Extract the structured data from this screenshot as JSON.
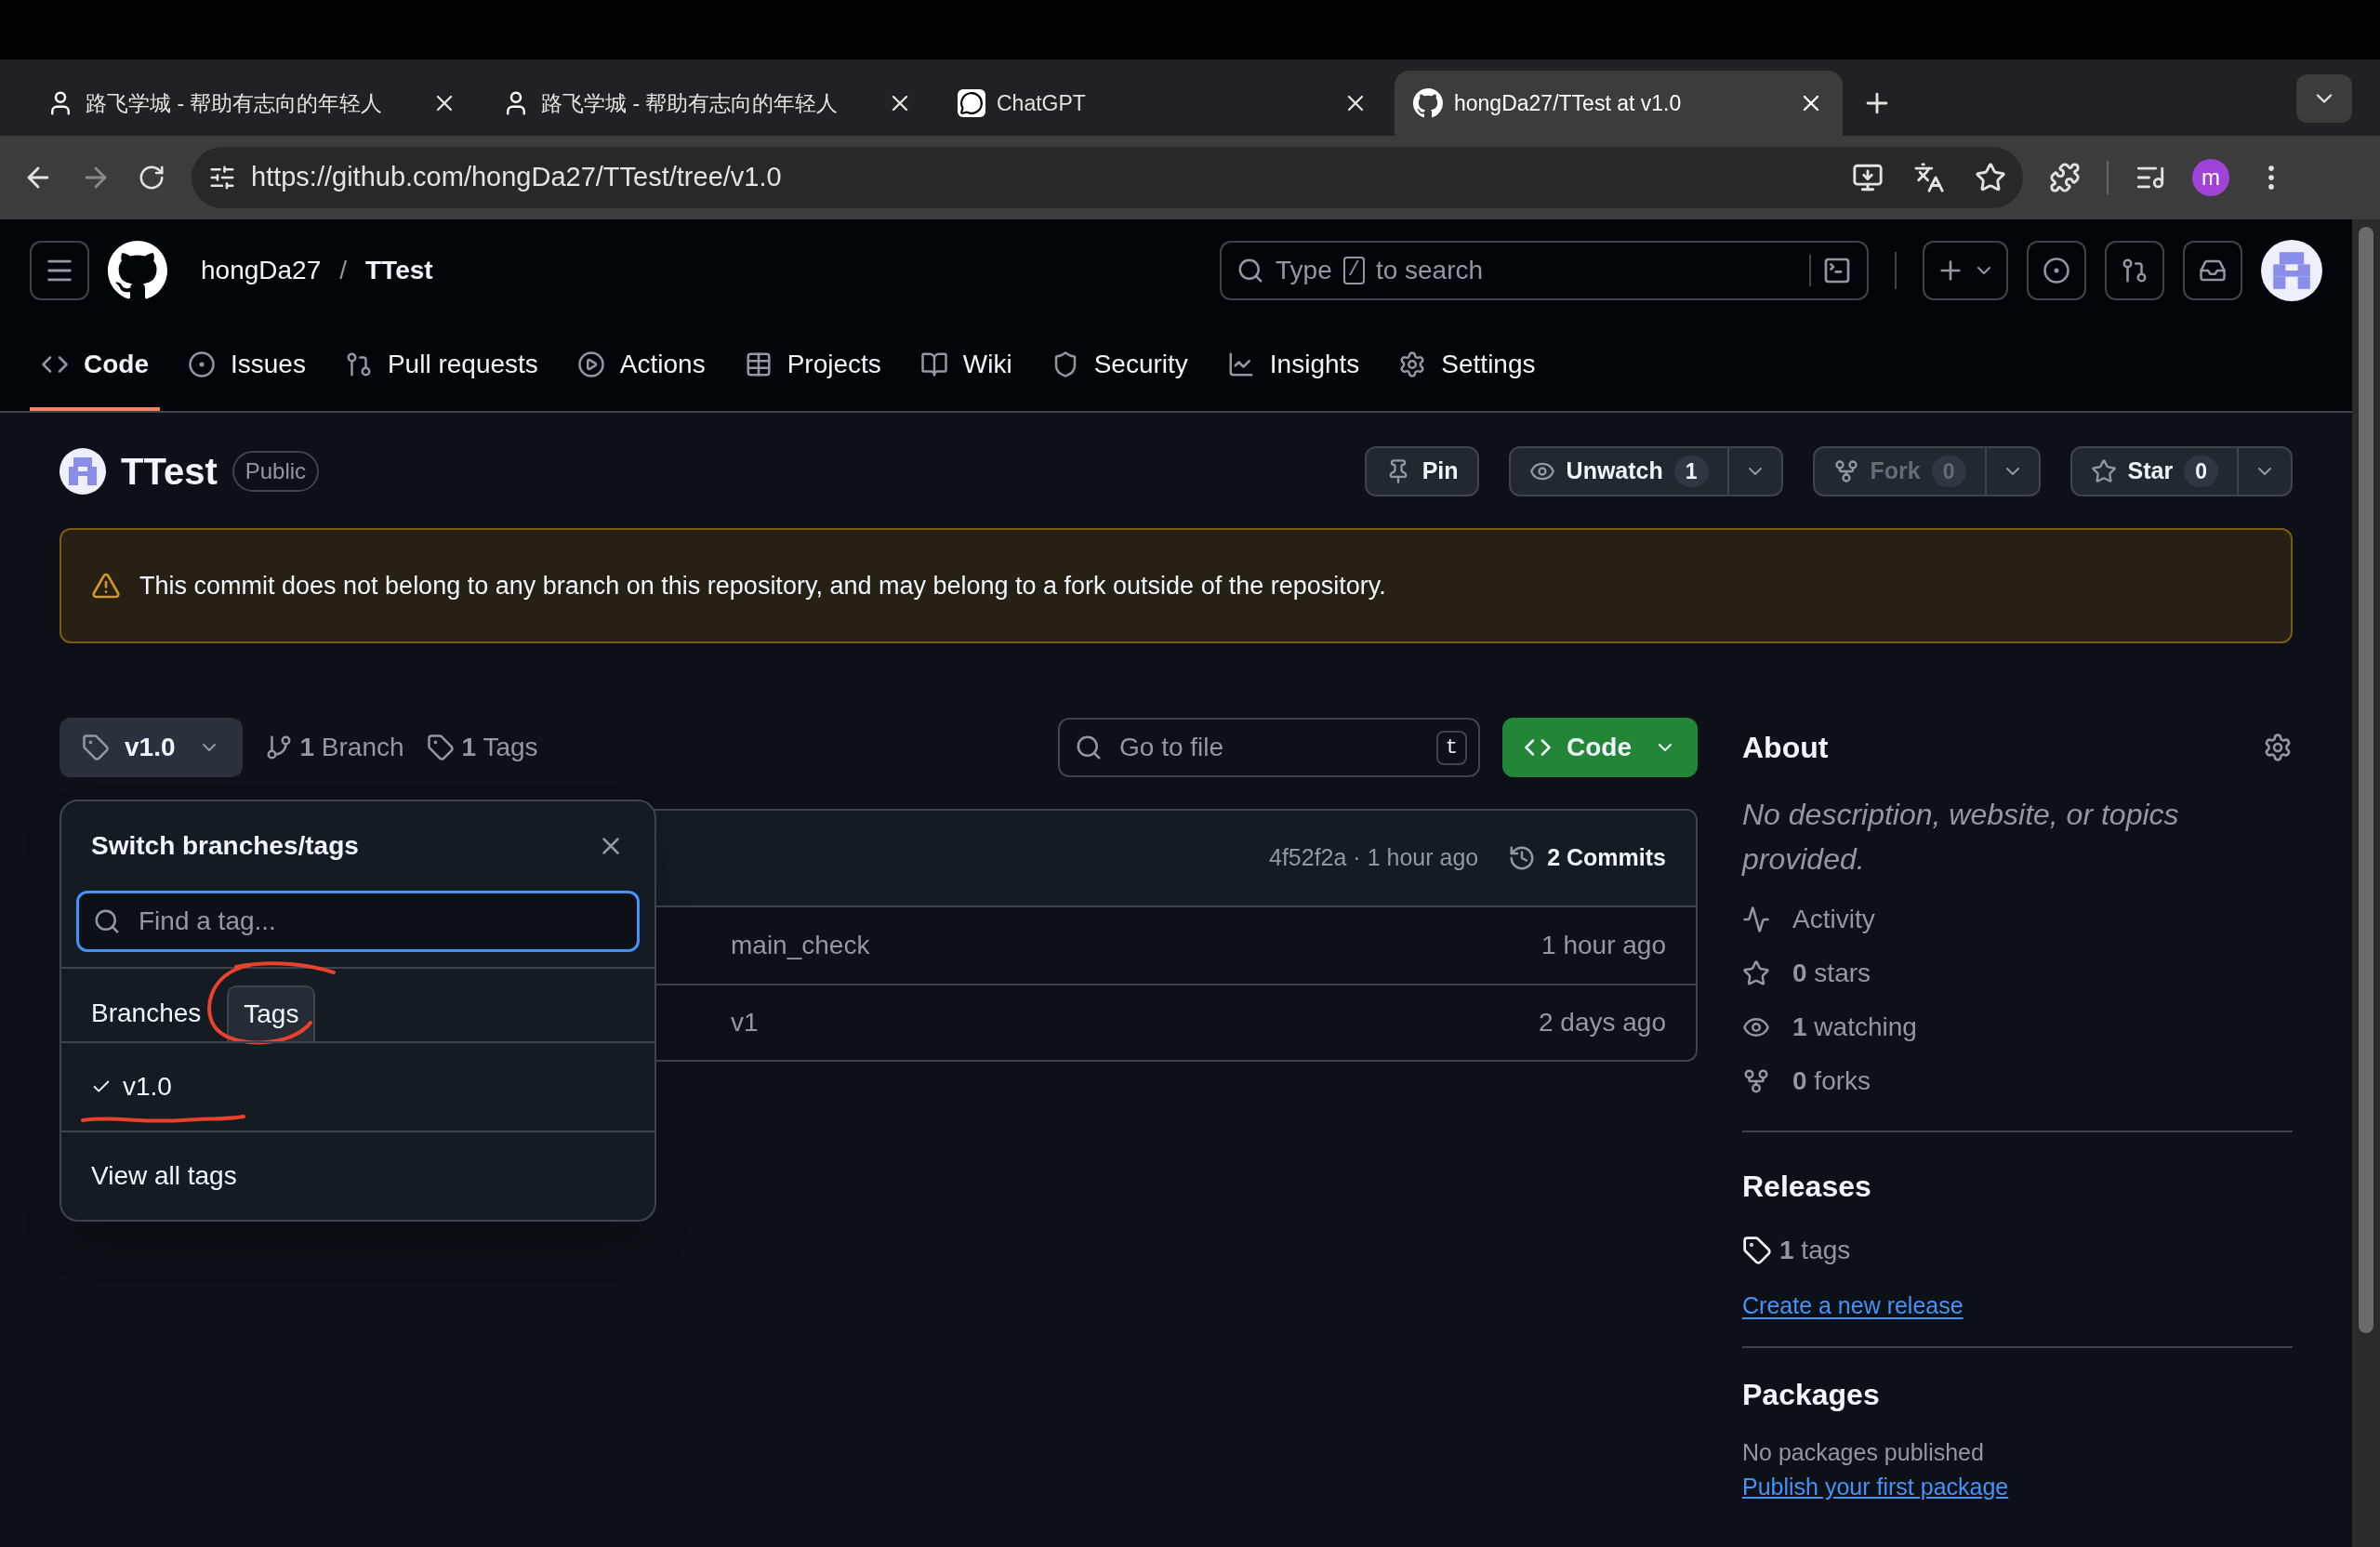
{
  "browser": {
    "tabs": [
      {
        "title": "路飞学城 - 帮助有志向的年轻人",
        "selected": false
      },
      {
        "title": "路飞学城 - 帮助有志向的年轻人",
        "selected": false
      },
      {
        "title": "ChatGPT",
        "selected": false
      },
      {
        "title": "hongDa27/TTest at v1.0",
        "selected": true
      }
    ],
    "url": "https://github.com/hongDa27/TTest/tree/v1.0",
    "profile": "m"
  },
  "header": {
    "owner": "hongDa27",
    "separator": "/",
    "repo": "TTest",
    "search": {
      "before": "Type",
      "key": "/",
      "after": "to search"
    }
  },
  "nav": [
    {
      "label": "Code",
      "selected": true
    },
    {
      "label": "Issues",
      "selected": false
    },
    {
      "label": "Pull requests",
      "selected": false
    },
    {
      "label": "Actions",
      "selected": false
    },
    {
      "label": "Projects",
      "selected": false
    },
    {
      "label": "Wiki",
      "selected": false
    },
    {
      "label": "Security",
      "selected": false
    },
    {
      "label": "Insights",
      "selected": false
    },
    {
      "label": "Settings",
      "selected": false
    }
  ],
  "repo": {
    "name": "TTest",
    "visibility": "Public",
    "actions": [
      {
        "label": "Pin",
        "disabled": false
      },
      {
        "label": "Unwatch",
        "count": "1",
        "disabled": false
      },
      {
        "label": "Fork",
        "count": "0",
        "disabled": true
      },
      {
        "label": "Star",
        "count": "0",
        "disabled": false
      }
    ]
  },
  "warning": "This commit does not belong to any branch on this repository, and may belong to a fork outside of the repository.",
  "toolbar": {
    "ref": "v1.0",
    "branches": "**1** Branch",
    "tags": "**1** Tags",
    "go_to_file": {
      "placeholder": "Go to file",
      "key": "t"
    },
    "code_button": "Code"
  },
  "ref_menu": {
    "title": "Switch branches/tags",
    "search": {
      "placeholder": "Find a tag..."
    },
    "tabs": [
      {
        "label": "Branches",
        "selected": false
      },
      {
        "label": "Tags",
        "selected": true
      }
    ],
    "items": [
      {
        "label": "v1.0",
        "checked": true
      }
    ],
    "footer": "View all tags"
  },
  "files": {
    "commit": "4f52f2a · 1 hour ago",
    "commits": "2 Commits",
    "rows": [
      {
        "message": "main_check",
        "time": "1 hour ago"
      },
      {
        "message": "v1",
        "time": "2 days ago"
      }
    ]
  },
  "about": {
    "title": "About",
    "description": "No description, website, or topics provided.",
    "stats": [
      "Activity",
      "**0** stars",
      "**1** watching",
      "**0** forks"
    ]
  },
  "releases": {
    "title": "Releases",
    "tags": "**1** tags",
    "link": "Create a new release"
  },
  "packages": {
    "title": "Packages",
    "text": "No packages published",
    "link": "Publish your first package"
  }
}
